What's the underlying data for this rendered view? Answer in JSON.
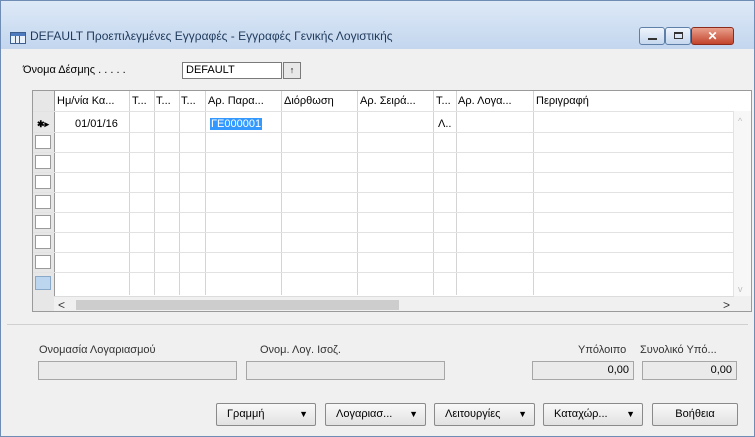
{
  "window": {
    "title": "DEFAULT Προεπιλεγμένες Εγγραφές - Εγγραφές Γενικής Λογιστικής",
    "controls": {
      "minimize": "–",
      "maximize": "□",
      "close": "✕"
    }
  },
  "batch": {
    "label": "Όνομα Δέσμης . . . . .",
    "value": "DEFAULT",
    "lookup_icon": "↑"
  },
  "grid": {
    "columns": [
      "Ημ/νία Κα...",
      "Τ...",
      "Τ...",
      "Τ...",
      "Αρ. Παρα...",
      "Διόρθωση",
      "Αρ. Σειρά...",
      "Τ...",
      "Αρ. Λογα...",
      "Περιγραφή"
    ],
    "row_marker": "✱▸",
    "rows": [
      {
        "date": "01/01/16",
        "doc_no": "ΓΕ000001",
        "type": "Λ.."
      }
    ],
    "hscroll_left": "<",
    "hscroll_right": ">",
    "vscroll_up": "^",
    "vscroll_down": "v"
  },
  "footer": {
    "account_name_label": "Ονομασία Λογαριασμού",
    "bal_account_name_label": "Ονομ. Λογ. Ισοζ.",
    "balance_label": "Υπόλοιπο",
    "total_balance_label": "Συνολικό Υπό...",
    "account_name_value": "",
    "bal_account_name_value": "",
    "balance_value": "0,00",
    "total_balance_value": "0,00"
  },
  "buttons": {
    "line": "Γραμμή",
    "account": "Λογαριασ...",
    "functions": "Λειτουργίες",
    "posting": "Καταχώρ...",
    "help": "Βοήθεια",
    "dropdown_glyph": "▼"
  }
}
